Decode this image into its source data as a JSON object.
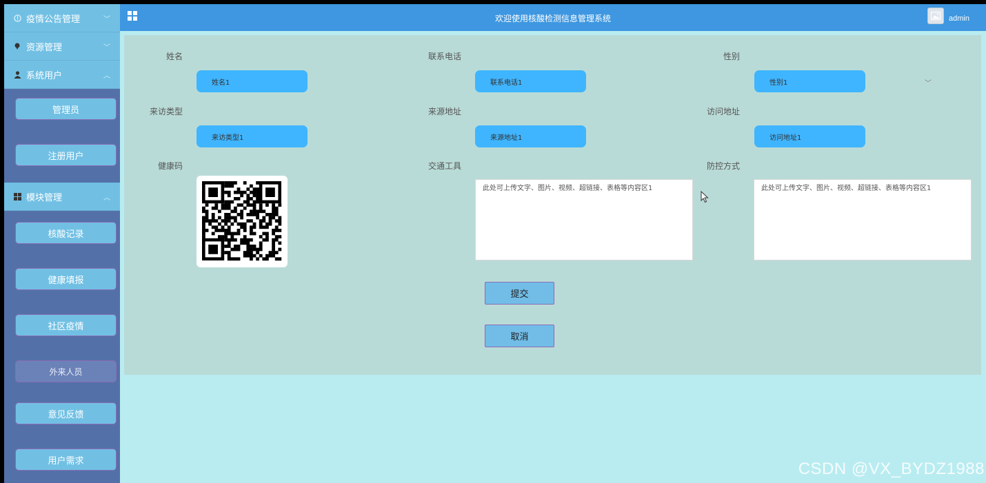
{
  "sidebar": {
    "groups": [
      {
        "label": "疫情公告管理",
        "icon": "info-icon",
        "chevron": "down"
      },
      {
        "label": "资源管理",
        "icon": "pin-icon",
        "chevron": "down"
      },
      {
        "label": "系统用户",
        "icon": "user-icon",
        "chevron": "up"
      },
      {
        "label": "模块管理",
        "icon": "grid-icon",
        "chevron": "up"
      }
    ],
    "users_items": [
      "管理员",
      "注册用户"
    ],
    "module_items": [
      "核酸记录",
      "健康填报",
      "社区疫情",
      "外来人员",
      "意见反馈",
      "用户需求"
    ],
    "active_item": "外来人员"
  },
  "header": {
    "title": "欢迎使用核酸检测信息管理系统",
    "username": "admin",
    "menu_icon": "grid-icon",
    "avatar_icon": "image-icon"
  },
  "form": {
    "name_label": "姓名",
    "name_value": "姓名1",
    "phone_label": "联系电话",
    "phone_value": "联系电话1",
    "gender_label": "性别",
    "gender_value": "性别1",
    "visit_type_label": "来访类型",
    "visit_type_value": "来访类型1",
    "source_addr_label": "来源地址",
    "source_addr_value": "来源地址1",
    "visit_addr_label": "访问地址",
    "visit_addr_value": "访问地址1",
    "health_code_label": "健康码",
    "transport_label": "交通工具",
    "transport_value": "此处可上传文字、图片、视频、超链接、表格等内容区1",
    "prevention_label": "防控方式",
    "prevention_value": "此处可上传文字、图片、视频、超链接、表格等内容区1",
    "submit_label": "提交",
    "cancel_label": "取消"
  },
  "watermark": "CSDN @VX_BYDZ1988",
  "colors": {
    "header": "#3e97e0",
    "sidebar": "#5371a8",
    "menu_item": "#71c0e4",
    "input_fill": "#3fb5ff",
    "panel": "#b9dbd7",
    "background": "#b9ecf0"
  }
}
